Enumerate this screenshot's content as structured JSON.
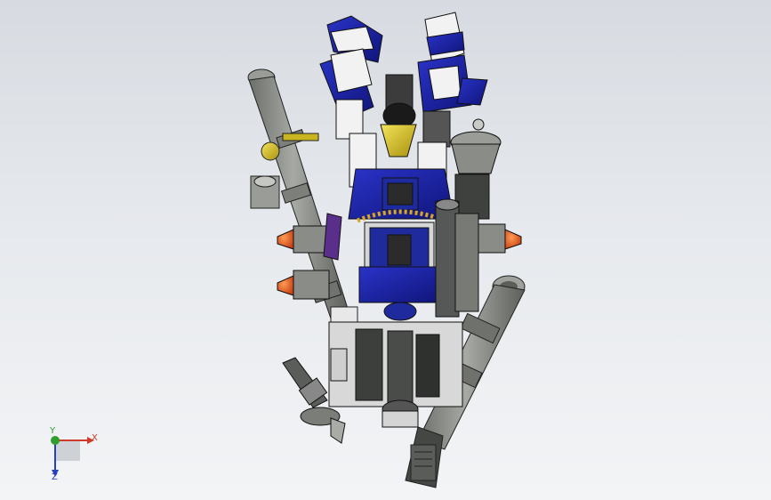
{
  "viewport": {
    "background_top": "#d7dbe1",
    "background_bottom": "#f3f4f6"
  },
  "model": {
    "palette": {
      "armor_blue": "#1c23a8",
      "armor_white": "#f2f2f2",
      "metal_gray": "#8a8d87",
      "dark_metal": "#3b3d3b",
      "gold": "#d8c21a",
      "orange_thruster": "#e0521d"
    }
  },
  "triad": {
    "x_label": "X",
    "y_label": "Y",
    "z_label": "Z",
    "x_color": "#d03a2a",
    "y_color": "#2f9e2f",
    "z_color": "#2a3fbf"
  }
}
